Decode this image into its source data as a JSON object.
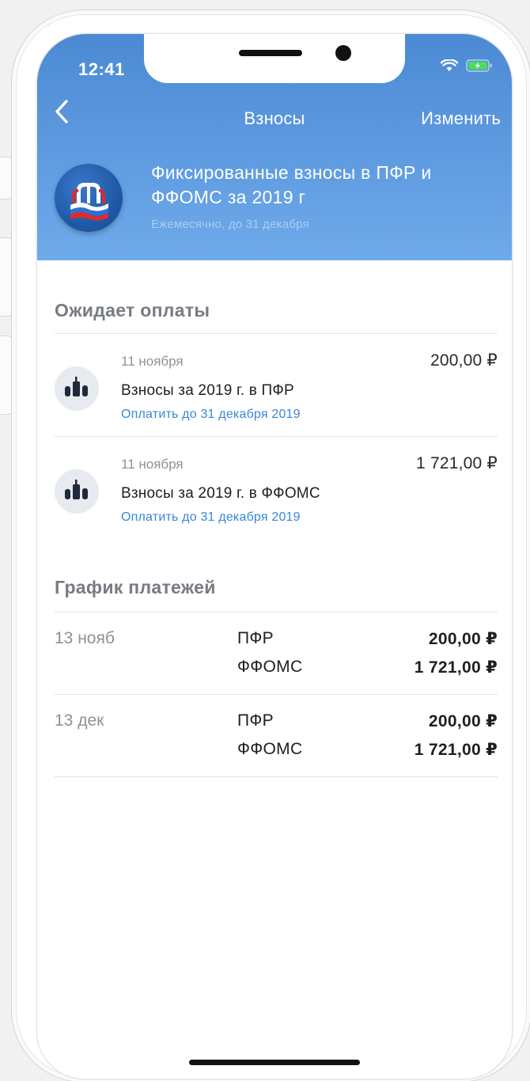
{
  "status_bar": {
    "time": "12:41"
  },
  "nav": {
    "title": "Взносы",
    "edit_label": "Изменить"
  },
  "header": {
    "title": "Фиксированные взносы в ПФР и ФФОМС за 2019 г",
    "subtitle": "Ежемесячно, до 31 декабря",
    "logo_text": "ПФ"
  },
  "pending": {
    "section_title": "Ожидает оплаты",
    "items": [
      {
        "date": "11 ноября",
        "amount": "200,00 ₽",
        "name": "Взносы за 2019 г. в ПФР",
        "deadline": "Оплатить до 31 декабря 2019"
      },
      {
        "date": "11 ноября",
        "amount": "1 721,00 ₽",
        "name": "Взносы за 2019 г. в ФФОМС",
        "deadline": "Оплатить до 31 декабря 2019"
      }
    ]
  },
  "schedule": {
    "section_title": "График платежей",
    "rows": [
      {
        "date": "13 нояб",
        "lines": [
          {
            "label": "ПФР",
            "value": "200,00 ₽"
          },
          {
            "label": "ФФОМС",
            "value": "1 721,00 ₽"
          }
        ]
      },
      {
        "date": "13 дек",
        "lines": [
          {
            "label": "ПФР",
            "value": "200,00 ₽"
          },
          {
            "label": "ФФОМС",
            "value": "1 721,00 ₽"
          }
        ]
      }
    ]
  },
  "colors": {
    "header_top": "#4b8ad3",
    "header_bottom": "#6faaea",
    "link": "#3a86d6",
    "section_title": "#777b82",
    "battery": "#4cd964"
  },
  "icons": {
    "back": "chevron-left-icon",
    "wifi": "wifi-icon",
    "battery": "battery-charging-icon",
    "payment": "building-icon"
  }
}
